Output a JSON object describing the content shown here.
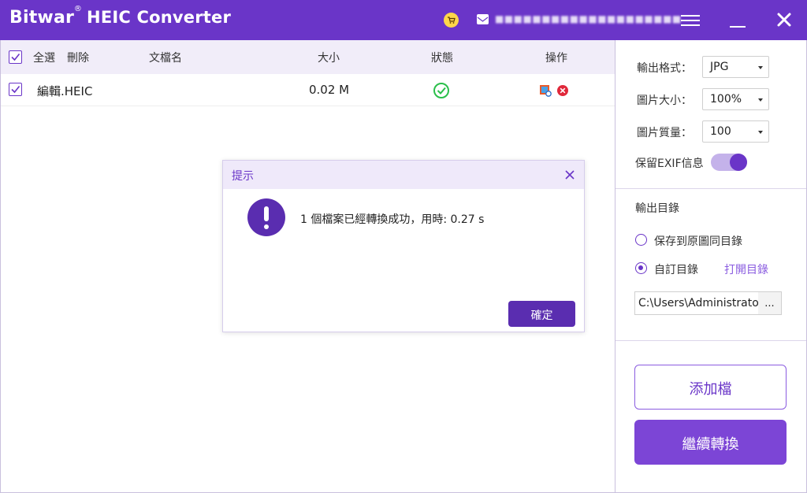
{
  "app": {
    "brand": "Bitwar",
    "registered": "®",
    "title": "HEIC Converter",
    "account_email": "■■■■■■■■■■■■■■■■■■■■",
    "icons": {
      "cart": "cart-icon",
      "mail": "mail-icon",
      "menu": "menu-icon",
      "minimize": "minimize-icon",
      "close": "close-icon"
    }
  },
  "table": {
    "select_all": "全選",
    "delete": "刪除",
    "col_filename": "文檔名",
    "col_size": "大小",
    "col_status": "狀態",
    "col_action": "操作",
    "rows": [
      {
        "checked": true,
        "filename": "編輯.HEIC",
        "size": "0.02 M",
        "status": "success-check-icon",
        "actions": [
          "preview-icon",
          "remove-icon"
        ]
      }
    ]
  },
  "settings": {
    "output_format_label": "輸出格式：",
    "output_format_value": "JPG",
    "image_size_label": "圖片大小：",
    "image_size_value": "100%",
    "image_quality_label": "圖片質量：",
    "image_quality_value": "100",
    "keep_exif_label": "保留EXIF信息",
    "keep_exif_on": true,
    "output_dir_title": "輸出目錄",
    "option_same_dir": "保存到原圖同目錄",
    "option_custom_dir": "自訂目錄",
    "open_dir_link": "打開目錄",
    "path_value": "C:\\Users\\Administrator",
    "browse": "...",
    "add_file": "添加檔",
    "continue_convert": "繼續轉換"
  },
  "dialog": {
    "title": "提示",
    "message": "1 個檔案已經轉換成功，用時: 0.27 s",
    "ok": "確定"
  },
  "colors": {
    "accent": "#6a35c8",
    "success": "#2bbf4b",
    "danger": "#e0283a"
  }
}
